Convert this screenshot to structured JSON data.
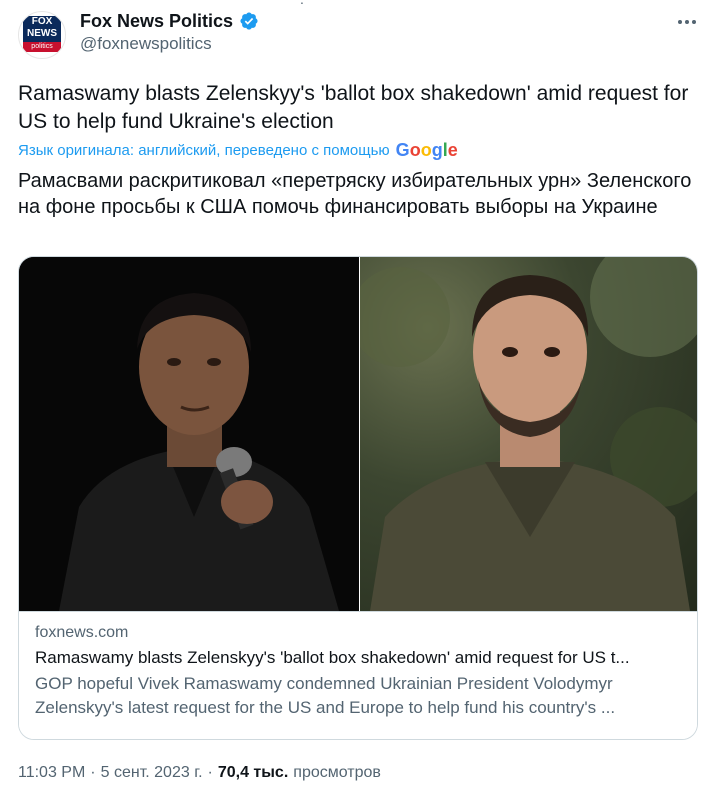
{
  "author": {
    "name": "Fox News Politics",
    "handle": "@foxnewspolitics",
    "avatar_top": "FOX NEWS",
    "avatar_bottom": "politics",
    "verified_color": "#1d9bf0"
  },
  "tweet": {
    "text_original": "Ramaswamy blasts Zelenskyy's 'ballot box shakedown' amid request for US to help fund Ukraine's election",
    "translation_note": "Язык оригинала: английский, переведено с помощью",
    "translation_provider": "Google",
    "text_translated": "Рамасвами раскритиковал «перетряску избирательных урн» Зеленского на фоне просьбы к США помочь финансировать выборы на Украине"
  },
  "card": {
    "domain": "foxnews.com",
    "title": "Ramaswamy blasts Zelenskyy's 'ballot box shakedown' amid request for US t...",
    "description": "GOP hopeful Vivek Ramaswamy condemned Ukrainian President Volodymyr Zelenskyy's latest request for the US and Europe to help fund his country's ..."
  },
  "meta": {
    "time": "11:03 PM",
    "date": "5 сент. 2023 г.",
    "views_count": "70,4 тыс.",
    "views_label": "просмотров",
    "separator": "·"
  },
  "icons": {
    "more": "more-horizontal-icon",
    "verified": "verified-badge-icon"
  },
  "colors": {
    "accent": "#1d9bf0",
    "secondary_text": "#536471"
  }
}
